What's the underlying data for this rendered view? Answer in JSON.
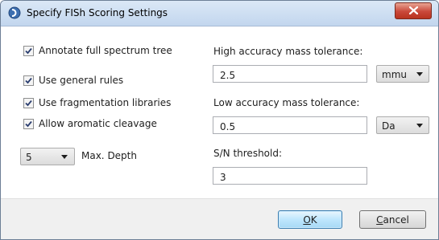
{
  "window": {
    "title": "Specify FISh Scoring Settings"
  },
  "options": {
    "annotate_full_spectrum_tree": {
      "label": "Annotate full spectrum tree",
      "checked": true
    },
    "use_general_rules": {
      "label": "Use general rules",
      "checked": true
    },
    "use_fragmentation_libraries": {
      "label": "Use fragmentation libraries",
      "checked": true
    },
    "allow_aromatic_cleavage": {
      "label": "Allow aromatic cleavage",
      "checked": true
    }
  },
  "max_depth": {
    "value": "5",
    "label": "Max. Depth"
  },
  "high_accuracy": {
    "label": "High accuracy mass tolerance:",
    "value": "2.5",
    "unit": "mmu"
  },
  "low_accuracy": {
    "label": "Low accuracy mass tolerance:",
    "value": "0.5",
    "unit": "Da"
  },
  "sn_threshold": {
    "label": "S/N threshold:",
    "value": "3"
  },
  "buttons": {
    "ok_mnemonic": "O",
    "ok_rest": "K",
    "cancel_mnemonic": "C",
    "cancel_rest": "ancel"
  },
  "colors": {
    "close_button": "#c9483a",
    "default_button_border": "#3c7fb1"
  }
}
